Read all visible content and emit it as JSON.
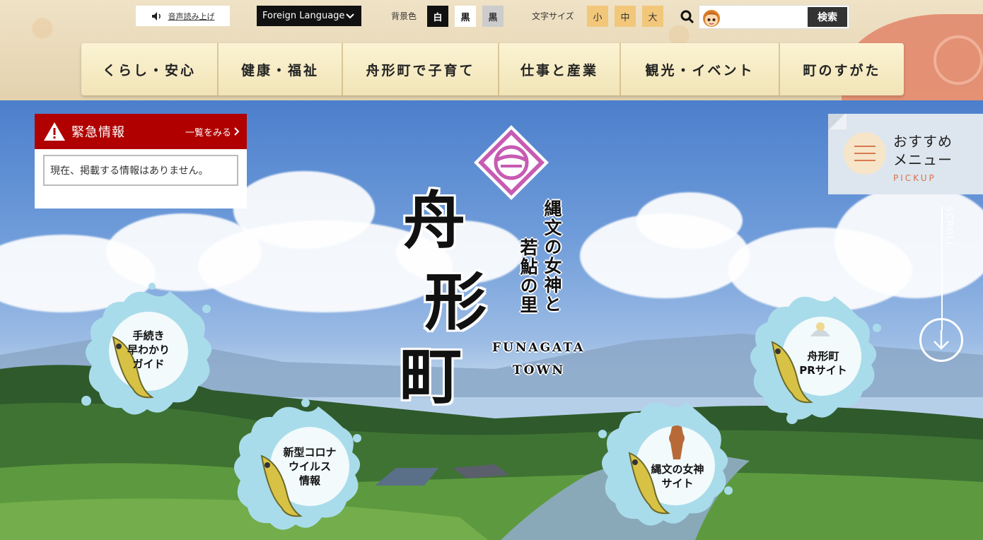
{
  "utility": {
    "read_aloud": "音声読み上げ",
    "foreign_language": "Foreign Language",
    "bg_color_label": "背景色",
    "bg_options": [
      "白",
      "黒",
      "黒"
    ],
    "font_size_label": "文字サイズ",
    "font_sizes": [
      "小",
      "中",
      "大"
    ],
    "search_placeholder": "",
    "search_button": "検索"
  },
  "nav": {
    "items": [
      "くらし・安心",
      "健康・福祉",
      "舟形町で子育て",
      "仕事と産業",
      "観光・イベント",
      "町のすがた"
    ]
  },
  "alert": {
    "title": "緊急情報",
    "more": "一覧をみる",
    "message": "現在、掲載する情報はありません。"
  },
  "pickup": {
    "title_line1": "おすすめ",
    "title_line2": "メニュー",
    "subtitle": "PICKUP"
  },
  "scroll_label": "SCROLL",
  "hero": {
    "town_name_chars": [
      "舟",
      "形",
      "町"
    ],
    "tagline_col1": "縄文の女神と",
    "tagline_col2": "若鮎の里",
    "romaji_line1": "FUNAGATA",
    "romaji_line2": "TOWN"
  },
  "splash_links": [
    {
      "line1": "手続き",
      "line2": "早わかり",
      "line3": "ガイド"
    },
    {
      "line1": "新型コロナ",
      "line2": "ウイルス",
      "line3": "情報"
    },
    {
      "line1": "縄文の女神",
      "line2": "サイト"
    },
    {
      "line1": "舟形町",
      "line2": "PRサイト"
    }
  ],
  "colors": {
    "alert_red": "#b00000",
    "nav_bg": "#f6ebc4",
    "font_size_btn": "#f2c77a",
    "pickup_accent": "#d9714b",
    "splash_blue": "#a9dcea"
  },
  "icons": {
    "read_aloud": "speaker-icon",
    "foreign": "chevron-down-icon",
    "search": "magnifier-icon",
    "alert": "warning-triangle-icon",
    "alert_more": "chevron-right-icon",
    "pickup": "hamburger-icon",
    "scroll": "arrow-down-icon"
  }
}
